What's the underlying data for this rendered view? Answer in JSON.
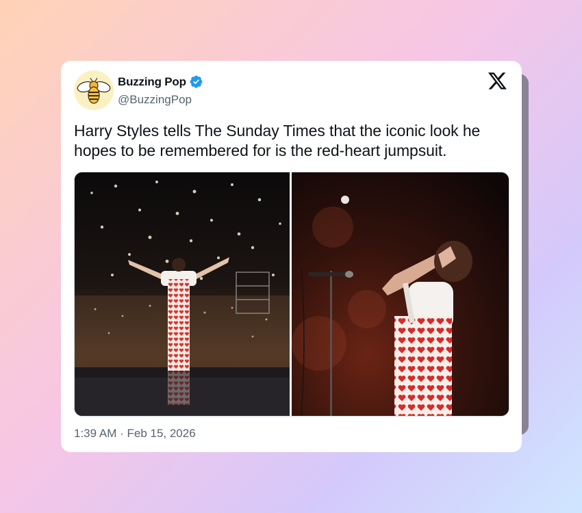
{
  "tweet": {
    "author_name": "Buzzing Pop",
    "author_handle": "@BuzzingPop",
    "verified": true,
    "text": "Harry Styles tells The Sunday Times that the iconic look he hopes to be remembered for is the red-heart jumpsuit.",
    "timestamp": "1:39 AM · Feb 15, 2026",
    "avatar_icon": "bee-icon",
    "platform_icon": "x-logo-icon"
  },
  "media": {
    "photos": [
      {
        "name": "concert-crowd-photo"
      },
      {
        "name": "microphone-performer-photo"
      }
    ]
  },
  "colors": {
    "card_background": "#ffffff",
    "text_primary": "#0f1419",
    "text_secondary": "#536471",
    "verified_blue": "#1d9bf0",
    "avatar_background": "#fbf0c2"
  }
}
